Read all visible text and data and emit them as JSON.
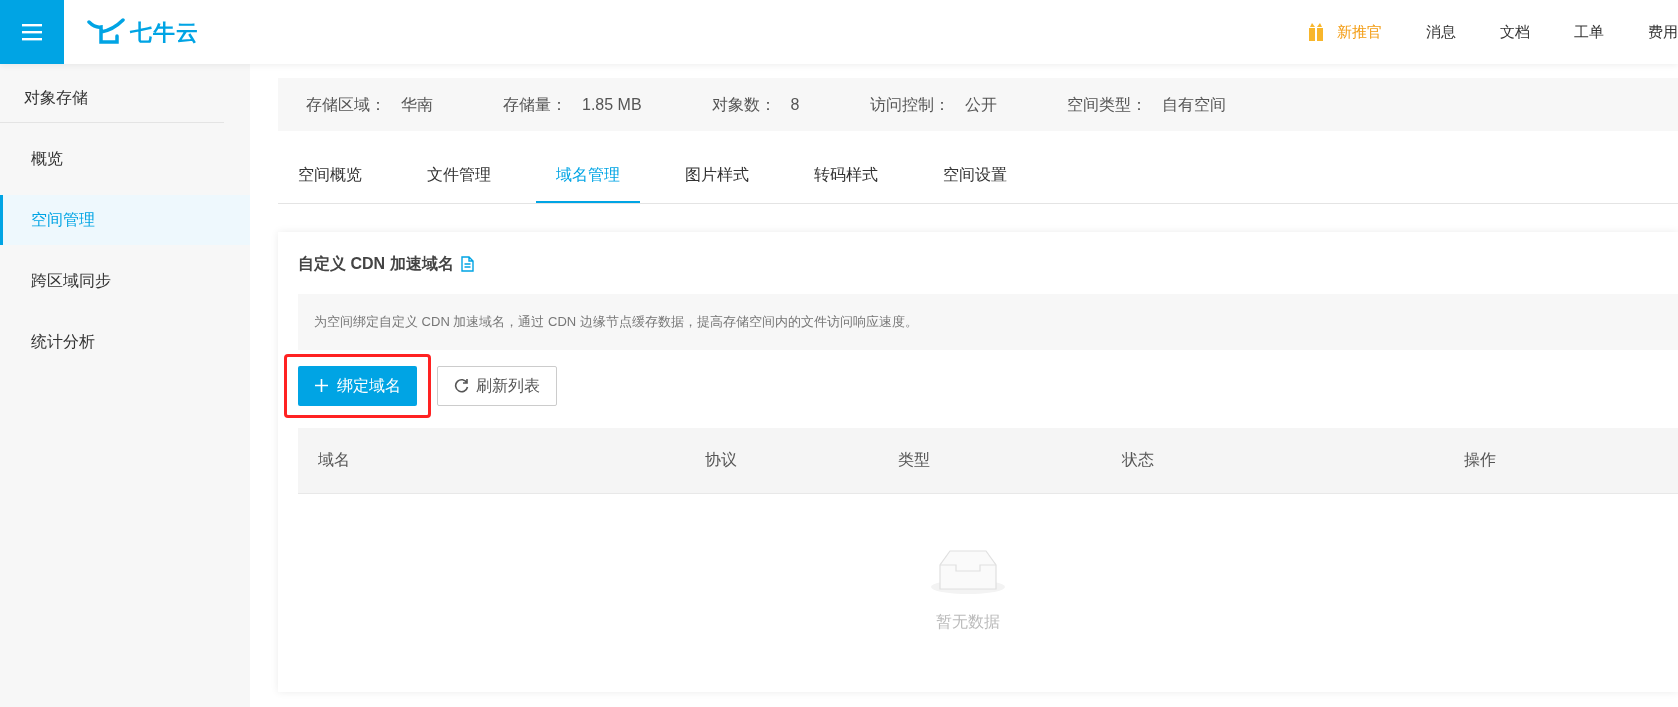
{
  "header": {
    "logo_text": "七牛云",
    "nav": [
      {
        "label": "新推官",
        "kind": "promo"
      },
      {
        "label": "消息",
        "kind": "link"
      },
      {
        "label": "文档",
        "kind": "link"
      },
      {
        "label": "工单",
        "kind": "link"
      },
      {
        "label": "费用",
        "kind": "link"
      }
    ]
  },
  "sidebar": {
    "title": "对象存储",
    "items": [
      {
        "label": "概览",
        "selected": false
      },
      {
        "label": "空间管理",
        "selected": true
      },
      {
        "label": "跨区域同步",
        "selected": false
      },
      {
        "label": "统计分析",
        "selected": false
      }
    ]
  },
  "info_bar": [
    {
      "label": "存储区域：",
      "value": "华南"
    },
    {
      "label": "存储量：",
      "value": "1.85 MB"
    },
    {
      "label": "对象数：",
      "value": "8"
    },
    {
      "label": "访问控制：",
      "value": "公开"
    },
    {
      "label": "空间类型：",
      "value": "自有空间"
    }
  ],
  "tabs": [
    {
      "label": "空间概览",
      "selected": false
    },
    {
      "label": "文件管理",
      "selected": false
    },
    {
      "label": "域名管理",
      "selected": true
    },
    {
      "label": "图片样式",
      "selected": false
    },
    {
      "label": "转码样式",
      "selected": false
    },
    {
      "label": "空间设置",
      "selected": false
    }
  ],
  "card": {
    "title": "自定义 CDN 加速域名",
    "description": "为空间绑定自定义 CDN 加速域名，通过 CDN 边缘节点缓存数据，提高存储空间内的文件访问响应速度。",
    "buttons": [
      {
        "label": "绑定域名",
        "kind": "primary",
        "highlighted": true
      },
      {
        "label": "刷新列表",
        "kind": "refresh"
      }
    ],
    "table": {
      "columns": [
        "域名",
        "协议",
        "类型",
        "状态",
        "操作"
      ],
      "empty_text": "暂无数据"
    }
  }
}
